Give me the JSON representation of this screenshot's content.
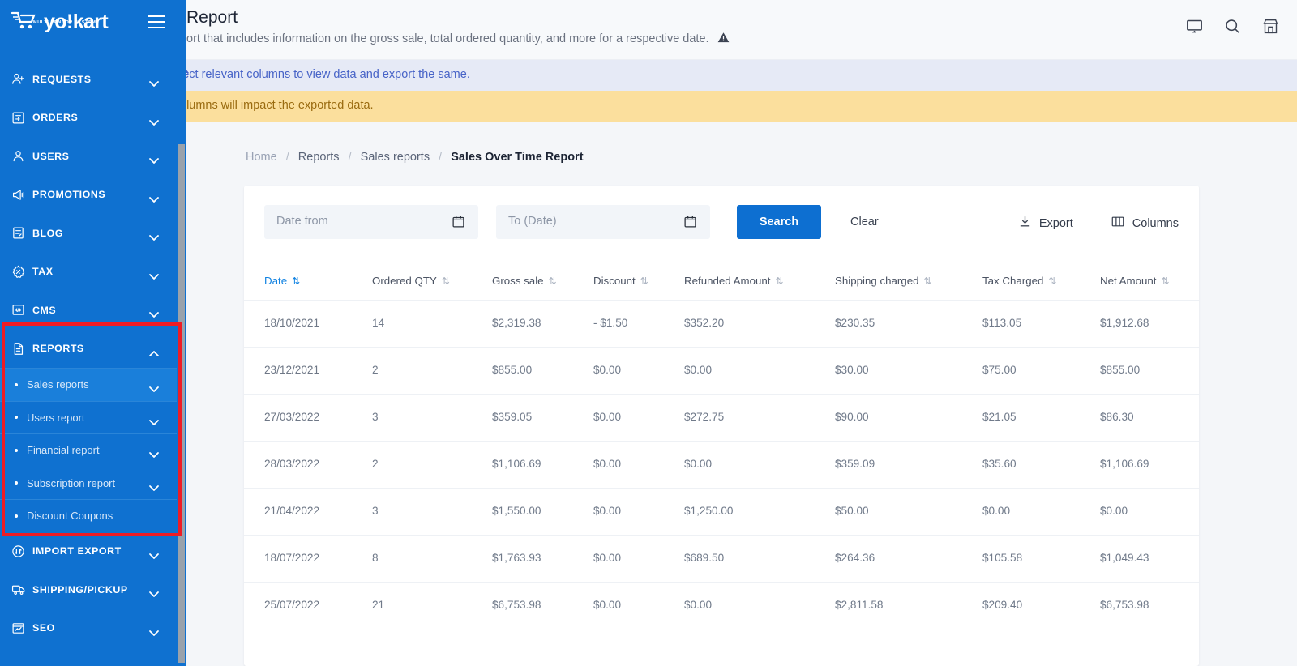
{
  "header": {
    "title": "Report",
    "description": "ort that includes information on the gross sale, total ordered quantity, and more for a respective date.",
    "icons": [
      "monitor-icon",
      "search-icon",
      "store-icon"
    ]
  },
  "banners": {
    "info": "lect relevant columns to view data and export the same.",
    "warning": "olumns will impact the exported data."
  },
  "sidebar": {
    "logo": {
      "text": "yo!kart",
      "tagline": "MULTI VENDOR SYSTEM"
    },
    "items": [
      {
        "label": "REQUESTS",
        "icon": "user-plus-icon",
        "expanded": false
      },
      {
        "label": "ORDERS",
        "icon": "orders-box-icon",
        "expanded": false
      },
      {
        "label": "USERS",
        "icon": "user-icon",
        "expanded": false
      },
      {
        "label": "PROMOTIONS",
        "icon": "megaphone-icon",
        "expanded": false
      },
      {
        "label": "BLOG",
        "icon": "blog-page-icon",
        "expanded": false
      },
      {
        "label": "TAX",
        "icon": "tax-percent-icon",
        "expanded": false
      },
      {
        "label": "CMS",
        "icon": "code-window-icon",
        "expanded": false
      },
      {
        "label": "REPORTS",
        "icon": "document-icon",
        "expanded": true
      },
      {
        "label": "IMPORT EXPORT",
        "icon": "import-export-icon",
        "expanded": false
      },
      {
        "label": "SHIPPING/PICKUP",
        "icon": "truck-icon",
        "expanded": false
      },
      {
        "label": "SEO",
        "icon": "seo-window-icon",
        "expanded": false
      }
    ],
    "reports_children": [
      {
        "label": "Sales reports",
        "has_chevron": true,
        "active": true
      },
      {
        "label": "Users report",
        "has_chevron": true,
        "active": false
      },
      {
        "label": "Financial report",
        "has_chevron": true,
        "active": false
      },
      {
        "label": "Subscription report",
        "has_chevron": true,
        "active": false
      },
      {
        "label": "Discount Coupons",
        "has_chevron": false,
        "active": false
      }
    ]
  },
  "breadcrumb": [
    {
      "label": "Home",
      "current": false
    },
    {
      "label": "Reports",
      "current": false
    },
    {
      "label": "Sales reports",
      "current": false
    },
    {
      "label": "Sales Over Time Report",
      "current": true
    }
  ],
  "filters": {
    "date_from": {
      "placeholder": "Date from",
      "value": ""
    },
    "date_to": {
      "placeholder": "To (Date)",
      "value": ""
    },
    "search_label": "Search",
    "clear_label": "Clear",
    "export_label": "Export",
    "columns_label": "Columns"
  },
  "colors": {
    "sidebar": "#0f71d0",
    "accent": "#0d6fd1",
    "highlight_box": "#ee1c25",
    "banner_info_bg": "#e6eaf6",
    "banner_warn_bg": "#fbdf9d",
    "active_sort": "#1283e2"
  },
  "table": {
    "columns": [
      {
        "label": "Date",
        "sortable": true,
        "active": true
      },
      {
        "label": "Ordered QTY",
        "sortable": true,
        "active": false
      },
      {
        "label": "Gross sale",
        "sortable": true,
        "active": false
      },
      {
        "label": "Discount",
        "sortable": true,
        "active": false
      },
      {
        "label": "Refunded Amount",
        "sortable": true,
        "active": false
      },
      {
        "label": "Shipping charged",
        "sortable": true,
        "active": false
      },
      {
        "label": "Tax Charged",
        "sortable": true,
        "active": false
      },
      {
        "label": "Net Amount",
        "sortable": true,
        "active": false
      }
    ],
    "rows": [
      [
        "18/10/2021",
        "14",
        "$2,319.38",
        "- $1.50",
        "$352.20",
        "$230.35",
        "$113.05",
        "$1,912.68"
      ],
      [
        "23/12/2021",
        "2",
        "$855.00",
        "$0.00",
        "$0.00",
        "$30.00",
        "$75.00",
        "$855.00"
      ],
      [
        "27/03/2022",
        "3",
        "$359.05",
        "$0.00",
        "$272.75",
        "$90.00",
        "$21.05",
        "$86.30"
      ],
      [
        "28/03/2022",
        "2",
        "$1,106.69",
        "$0.00",
        "$0.00",
        "$359.09",
        "$35.60",
        "$1,106.69"
      ],
      [
        "21/04/2022",
        "3",
        "$1,550.00",
        "$0.00",
        "$1,250.00",
        "$50.00",
        "$0.00",
        "$0.00"
      ],
      [
        "18/07/2022",
        "8",
        "$1,763.93",
        "$0.00",
        "$689.50",
        "$264.36",
        "$105.58",
        "$1,049.43"
      ],
      [
        "25/07/2022",
        "21",
        "$6,753.98",
        "$0.00",
        "$0.00",
        "$2,811.58",
        "$209.40",
        "$6,753.98"
      ]
    ]
  }
}
